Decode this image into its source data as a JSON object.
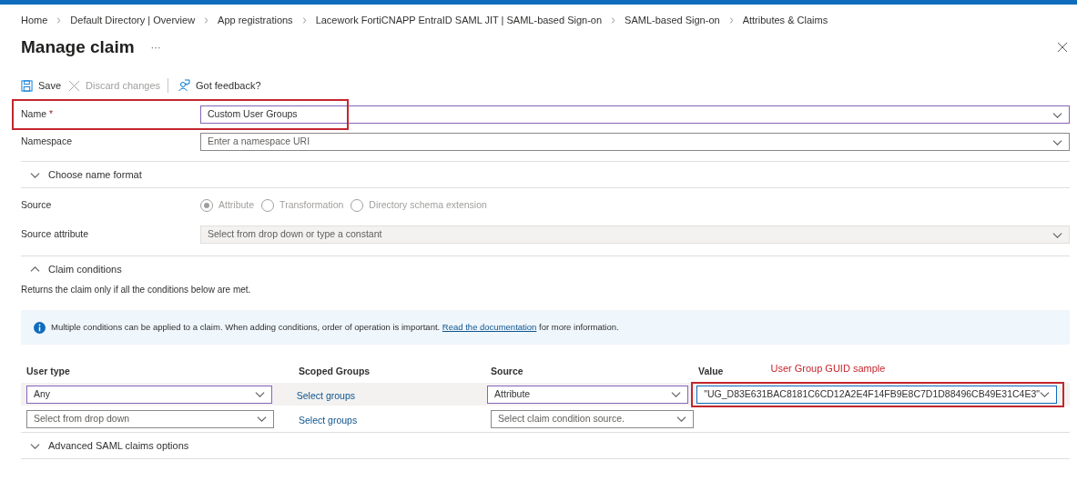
{
  "breadcrumbs": [
    "Home",
    "Default Directory | Overview",
    "App registrations",
    "Lacework FortiCNAPP EntraID SAML JIT | SAML-based Sign-on",
    "SAML-based Sign-on",
    "Attributes & Claims"
  ],
  "title": "Manage claim",
  "more_button": "···",
  "toolbar": [
    {
      "kind": "save",
      "label": "Save",
      "disabled": false
    },
    {
      "kind": "discard",
      "label": "Discard changes",
      "disabled": true
    },
    {
      "kind": "feedback",
      "label": "Got feedback?",
      "disabled": false
    }
  ],
  "name_field": {
    "label": "Name",
    "required_mark": "*",
    "value": "Custom User Groups",
    "highlighted": true
  },
  "namespace_field": {
    "label": "Namespace",
    "placeholder": "Enter a namespace URI"
  },
  "name_format_section": {
    "label": "Choose name format",
    "expanded": false
  },
  "source": {
    "label": "Source",
    "disabled": true,
    "options": [
      {
        "label": "Attribute",
        "selected": true
      },
      {
        "label": "Transformation",
        "selected": false
      },
      {
        "label": "Directory schema extension",
        "selected": false
      }
    ]
  },
  "source_attribute": {
    "label": "Source attribute",
    "placeholder": "Select from drop down or type a constant",
    "disabled": true
  },
  "claim_conditions": {
    "label": "Claim conditions",
    "expanded": true,
    "description": "Returns the claim only if all the conditions below are met.",
    "info": {
      "text": "Multiple conditions can be applied to a claim.  When adding conditions, order of operation is important.",
      "link": "Read the documentation",
      "suffix": "for more information."
    },
    "columns": [
      "User type",
      "Scoped Groups",
      "Source",
      "Value"
    ],
    "annotation": "User Group GUID sample",
    "rows": [
      {
        "selected": true,
        "user_type": {
          "value": "Any"
        },
        "scoped_groups": "Select groups",
        "source": {
          "value": "Attribute"
        },
        "value": {
          "value": "\"UG_D83E631BAC8181C6CD12A2E4F14FB9E8C7D1D88496CB49E31C4E3\"",
          "highlighted": true
        }
      },
      {
        "selected": false,
        "user_type": {
          "placeholder": "Select from drop down"
        },
        "scoped_groups": "Select groups",
        "source": {
          "placeholder": "Select claim condition source."
        }
      }
    ]
  },
  "advanced_section": {
    "label": "Advanced SAML claims options",
    "expanded": false
  }
}
